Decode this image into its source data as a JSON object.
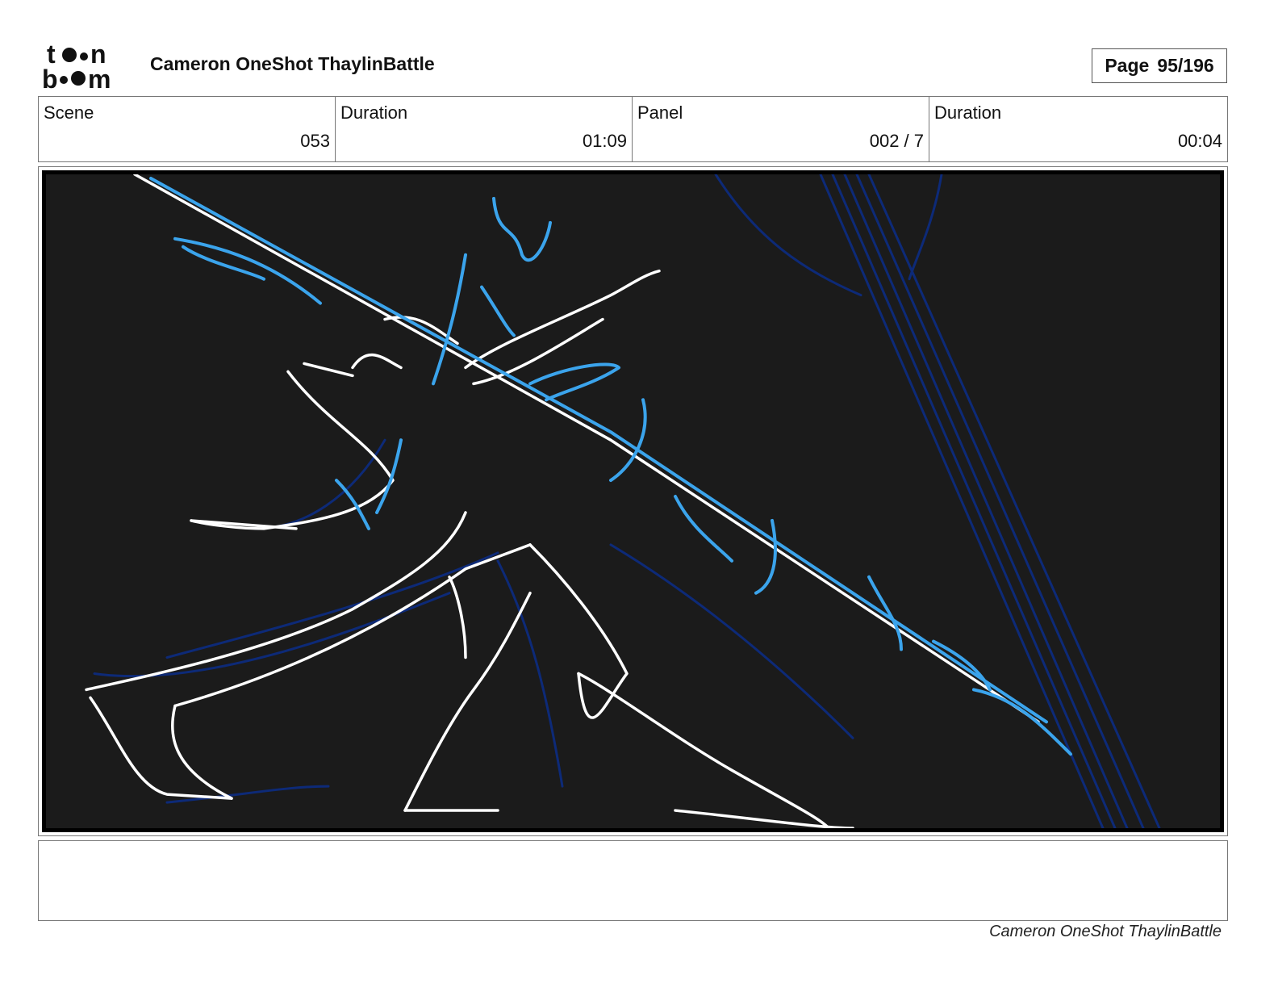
{
  "header": {
    "logo_text": "toon boom",
    "project_title": "Cameron OneShot ThaylinBattle",
    "page_label": "Page",
    "page_value": "95/196"
  },
  "info": [
    {
      "label": "Scene",
      "value": "053"
    },
    {
      "label": "Duration",
      "value": "01:09"
    },
    {
      "label": "Panel",
      "value": "002 / 7"
    },
    {
      "label": "Duration",
      "value": "00:04"
    }
  ],
  "panel": {
    "background_color": "#1b1b1b",
    "stroke_colors": {
      "white": "#ffffff",
      "light_blue": "#3ba4ec",
      "dark_blue": "#0d2a78"
    }
  },
  "notes": {
    "text": ""
  },
  "footer": {
    "title": "Cameron OneShot ThaylinBattle"
  }
}
